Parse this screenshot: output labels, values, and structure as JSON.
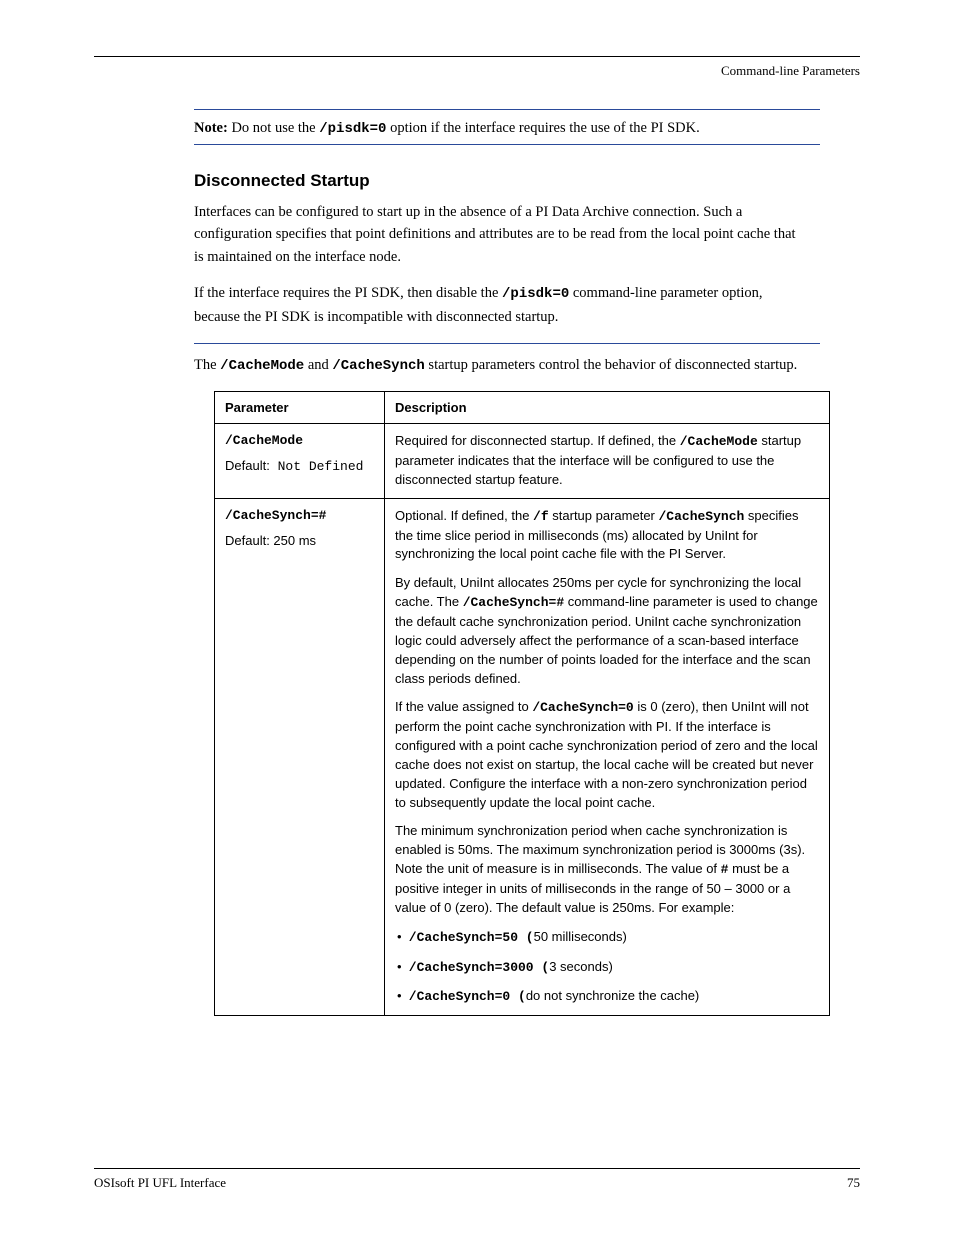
{
  "running_head": "Command-line Parameters",
  "note1": {
    "label": "Note:",
    "text_before": " Do not use the ",
    "code": "/pisdk=0",
    "text_after": " option if the interface requires the use of the PI SDK."
  },
  "heading2": "Disconnected Startup",
  "body_p1": "Interfaces can be configured to start up in the absence of a PI Data Archive connection. Such a configuration specifies that point definitions and attributes are to be read from the local point cache that is maintained on the interface node.",
  "body_p2_before": "If the interface requires the PI SDK, then disable the ",
  "body_p2_code": "/pisdk=0",
  "body_p2_after": " command-line parameter option, because the PI SDK is incompatible with disconnected startup.",
  "body_p3_before": "The ",
  "body_p3_code1": "/CacheMode",
  "body_p3_mid": " and ",
  "body_p3_code2": "/CacheSynch",
  "body_p3_after": " startup parameters control the behavior of disconnected startup.",
  "table": {
    "header1": "Parameter",
    "header2": "Description",
    "row1": {
      "param": "/CacheMode",
      "default_label": "Default:",
      "default_value": " Not Defined",
      "desc_before": "Required for disconnected startup. If defined, the ",
      "desc_code": "/CacheMode",
      "desc_after": " startup parameter indicates that the interface will be configured to use the disconnected startup feature."
    },
    "row2": {
      "param": "/CacheSynch=#",
      "default_label": "Default:",
      "default_value": " 250 ms",
      "p1_before": "Optional. If defined, the ",
      "p1_code1": "/f",
      "p1_mid": " startup parameter ",
      "p1_code2": "/CacheSynch",
      "p1_after": " specifies the time slice period in milliseconds (ms) allocated by UniInt for synchronizing the local point cache file with the PI Server.",
      "p2_before": "By default, UniInt allocates 250ms per cycle for synchronizing the local cache. The ",
      "p2_code": "/CacheSynch=#",
      "p2_after": " command-line parameter is used to change the default cache synchronization period. UniInt cache synchronization logic could adversely affect the performance of a scan-based interface depending on the number of points loaded for the interface and the scan class periods defined.",
      "p3_before": "If the value assigned to ",
      "p3_code": "/CacheSynch=0",
      "p3_after": " is 0 (zero), then UniInt will not perform the point cache synchronization with PI. If the interface is configured with a point cache synchronization period of zero and the local cache does not exist on startup, the local cache will be created but never updated. Configure the interface with a non-zero synchronization period to subsequently update the local point cache.",
      "p4_before": "The minimum synchronization period when cache synchronization is enabled is 50ms. The maximum synchronization period is 3000ms (3s). Note the unit of measure is in milliseconds. The value of ",
      "p4_code": "#",
      "p4_after": " must be a positive integer in units of milliseconds in the range of 50 – 3000 or a value of 0 (zero). The default value is 250ms. For example:",
      "bullets": [
        {
          "code": "/CacheSynch=50 (",
          "text": "50 milliseconds)"
        },
        {
          "code": "/CacheSynch=3000 (",
          "text": "3 seconds)"
        },
        {
          "code": "/CacheSynch=0 (",
          "text": "do not synchronize the cache)"
        }
      ]
    }
  },
  "footer_left": "OSIsoft PI UFL Interface",
  "footer_right": "75"
}
